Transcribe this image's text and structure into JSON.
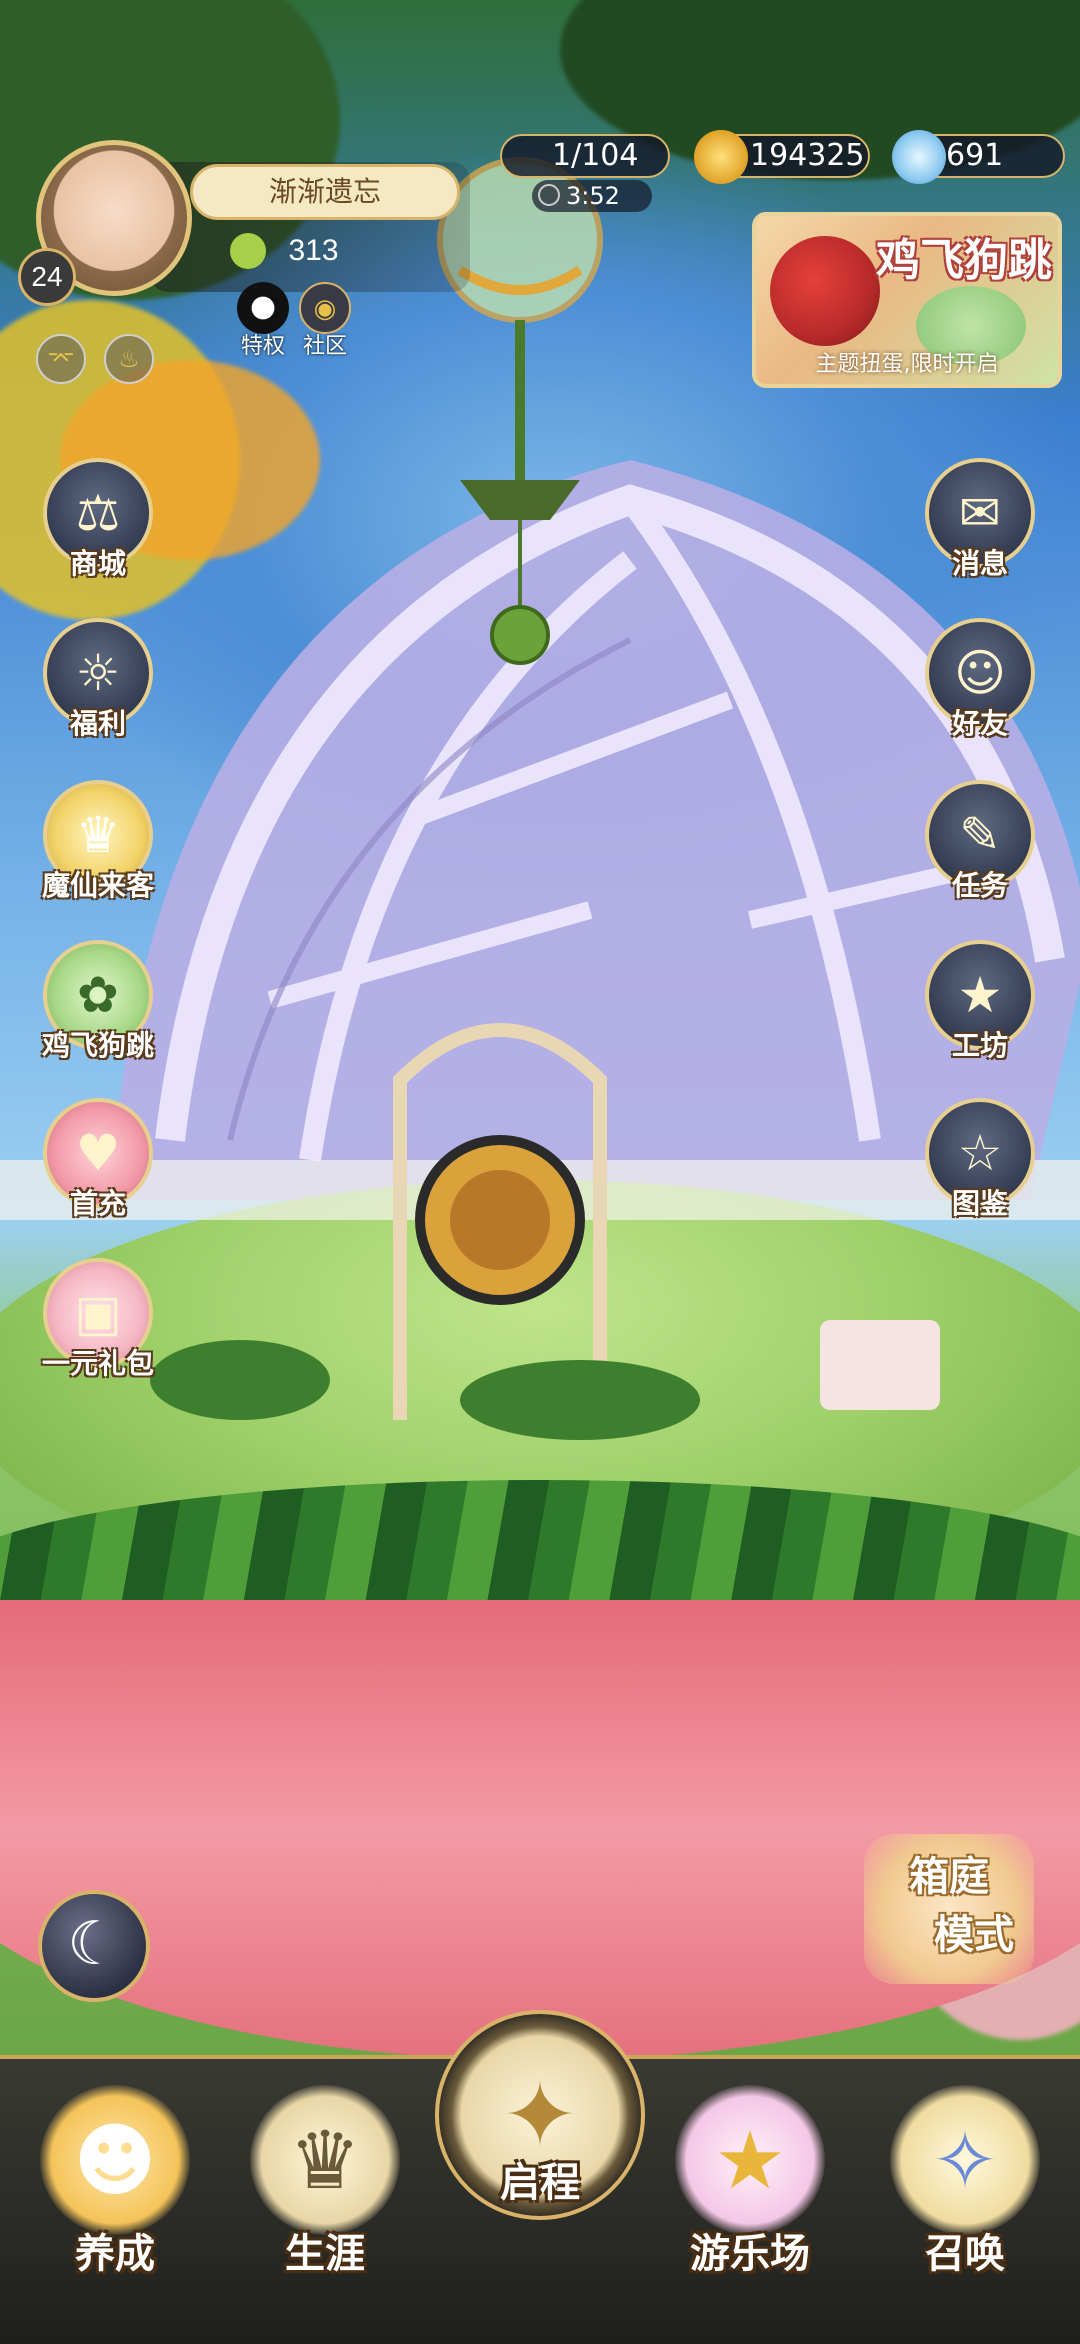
{
  "player": {
    "name": "渐渐遗忘",
    "level": "24",
    "clover_count": "313",
    "privilege_label": "特权",
    "community_label": "社区"
  },
  "resources": {
    "stamina": "1/104",
    "stamina_timer": "3:52",
    "gold": "194325",
    "diamond": "691"
  },
  "banner": {
    "title": "鸡飞狗跳",
    "subtitle": "主题扭蛋,限时开启"
  },
  "left_menu": [
    {
      "label": "商城",
      "icon": "balance-scale-icon"
    },
    {
      "label": "福利",
      "icon": "globe-gift-icon"
    },
    {
      "label": "魔仙来客",
      "icon": "crown-wreath-icon"
    },
    {
      "label": "鸡飞狗跳",
      "icon": "green-pet-icon"
    },
    {
      "label": "首充",
      "icon": "pink-bag-icon"
    },
    {
      "label": "一元礼包",
      "icon": "gift-box-icon"
    }
  ],
  "right_menu": [
    {
      "label": "消息",
      "icon": "envelope-icon"
    },
    {
      "label": "好友",
      "icon": "friend-icon"
    },
    {
      "label": "任务",
      "icon": "clipboard-icon"
    },
    {
      "label": "工坊",
      "icon": "mirror-icon"
    },
    {
      "label": "图鉴",
      "icon": "card-album-icon"
    }
  ],
  "garden_mode": {
    "line1": "箱庭",
    "line2": "模式"
  },
  "bottom_nav": [
    {
      "label": "养成",
      "icon": "girl-face-icon"
    },
    {
      "label": "生涯",
      "icon": "crown-icon"
    },
    {
      "label": "启程",
      "icon": "book-butterfly-icon"
    },
    {
      "label": "游乐场",
      "icon": "star-badge-icon"
    },
    {
      "label": "召唤",
      "icon": "sparkle-card-icon"
    }
  ],
  "colors": {
    "gold_border": "#d7b46a",
    "dark_panel": "#141828",
    "pink_base": "#e56b78"
  }
}
